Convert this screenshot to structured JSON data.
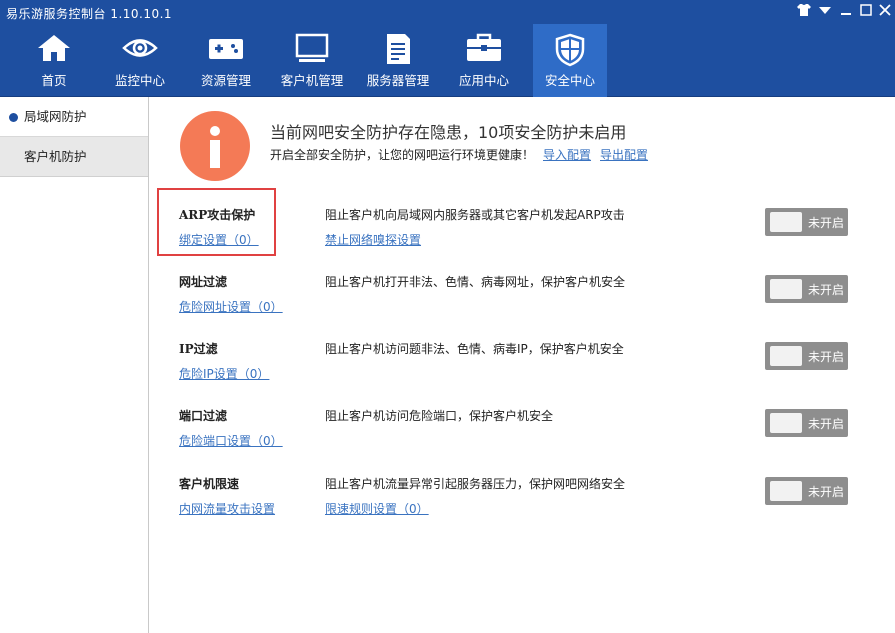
{
  "window": {
    "title": "易乐游服务控制台 1.10.10.1",
    "controls": [
      "shirt-icon",
      "menu-down-icon",
      "minimize-icon",
      "maximize-icon",
      "close-icon"
    ]
  },
  "nav": {
    "items": [
      {
        "label": "首页",
        "icon": "home-icon"
      },
      {
        "label": "监控中心",
        "icon": "eye-icon"
      },
      {
        "label": "资源管理",
        "icon": "gamepad-icon"
      },
      {
        "label": "客户机管理",
        "icon": "monitor-icon"
      },
      {
        "label": "服务器管理",
        "icon": "server-icon"
      },
      {
        "label": "应用中心",
        "icon": "toolbox-icon"
      },
      {
        "label": "安全中心",
        "icon": "shield-icon",
        "active": true
      }
    ]
  },
  "sidebar": {
    "items": [
      {
        "label": "局域网防护",
        "active": true
      },
      {
        "label": "客户机防护"
      }
    ]
  },
  "header": {
    "headline": "当前网吧安全防护存在隐患，10项安全防护未启用",
    "subline": "开启全部安全防护，让您的网吧运行环境更健康！",
    "import_link": "导入配置",
    "export_link": "导出配置"
  },
  "rows": [
    {
      "name": "ARP攻击保护",
      "setting": "绑定设置（0）",
      "desc": "阻止客户机向局域网内服务器或其它客户机发起ARP攻击",
      "desc_link": "禁止网络嗅探设置",
      "toggle": "未开启"
    },
    {
      "name": "网址过滤",
      "setting": "危险网址设置（0）",
      "desc": "阻止客户机打开非法、色情、病毒网址，保护客户机安全",
      "desc_link": "",
      "toggle": "未开启"
    },
    {
      "name": "IP过滤",
      "setting": "危险IP设置（0）",
      "desc": "阻止客户机访问题非法、色情、病毒IP，保护客户机安全",
      "desc_link": "",
      "toggle": "未开启"
    },
    {
      "name": "端口过滤",
      "setting": "危险端口设置（0）",
      "desc": "阻止客户机访问危险端口，保护客户机安全",
      "desc_link": "",
      "toggle": "未开启"
    },
    {
      "name": "客户机限速",
      "setting": "内网流量攻击设置",
      "desc": "阻止客户机流量异常引起服务器压力，保护网吧网络安全",
      "desc_link": "限速规则设置（0）",
      "toggle": "未开启"
    }
  ],
  "colors": {
    "nav_bg": "#1e4fa0",
    "nav_active": "#2f6cc7",
    "info_circle": "#f47a56",
    "link": "#3a73c0",
    "toggle_off": "#8e8e8e",
    "highlight": "#e04141"
  }
}
